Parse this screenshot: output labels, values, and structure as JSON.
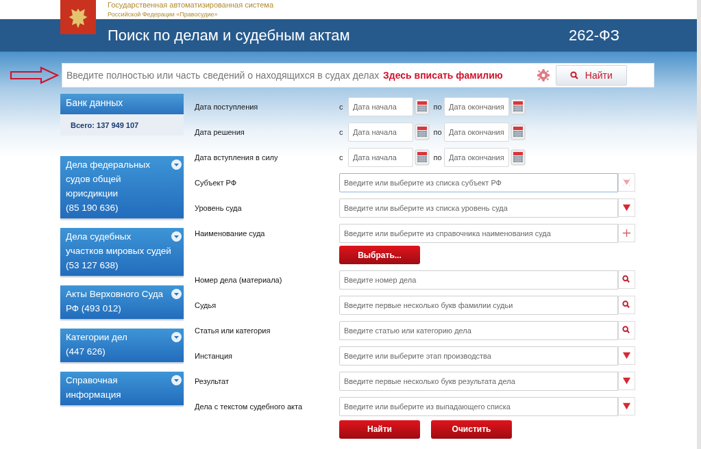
{
  "header": {
    "system_line_1": "Государственная автоматизированная система",
    "system_line_2": "Российской Федерации «Правосудие»",
    "title": "Поиск по делам и судебным актам",
    "law": "262-ФЗ"
  },
  "search": {
    "placeholder": "Введите полностью или часть сведений о находящихся в судах делах",
    "annotation": "Здесь вписать фамилию",
    "button": "Найти"
  },
  "sidebar": {
    "bank_title": "Банк данных",
    "total": "Всего: 137 949 107",
    "items": [
      {
        "lines": [
          "Дела федеральных",
          "судов общей",
          "юрисдикции",
          "(85 190 636)"
        ]
      },
      {
        "lines": [
          "Дела судебных",
          "участков мировых судей",
          "(53 127 638)"
        ]
      },
      {
        "lines": [
          "Акты Верховного Суда",
          "РФ (493 012)"
        ]
      },
      {
        "lines": [
          "Категории дел",
          "(447 626)"
        ]
      },
      {
        "lines": [
          "Справочная",
          "информация"
        ]
      }
    ]
  },
  "form": {
    "rows": [
      {
        "kind": "date",
        "label": "Дата поступления",
        "from": "с",
        "from_placeholder": "Дата начала",
        "to": "по",
        "to_placeholder": "Дата окончания"
      },
      {
        "kind": "date",
        "label": "Дата решения",
        "from": "с",
        "from_placeholder": "Дата начала",
        "to": "по",
        "to_placeholder": "Дата окончания"
      },
      {
        "kind": "date",
        "label": "Дата вступления в силу",
        "from": "с",
        "from_placeholder": "Дата начала",
        "to": "по",
        "to_placeholder": "Дата окончания"
      },
      {
        "kind": "field",
        "label": "Субъект РФ",
        "placeholder": "Введите или выберите из списка субъект РФ",
        "button": {
          "kind": "loading"
        },
        "focused": true
      },
      {
        "kind": "field",
        "label": "Уровень суда",
        "placeholder": "Введите или выберите из списка уровень суда",
        "button": {
          "kind": "dropdown"
        },
        "focused": false
      },
      {
        "kind": "field",
        "label": "Наименование суда",
        "placeholder": "Введите или выберите из справочника наименования суда",
        "button": {
          "kind": "add"
        },
        "focused": false,
        "extra_button": "Выбрать..."
      },
      {
        "kind": "field",
        "label": "Номер дела (материала)",
        "placeholder": "Введите номер дела",
        "button": {
          "kind": "search"
        },
        "focused": false
      },
      {
        "kind": "field",
        "label": "Судья",
        "placeholder": "Введите первые несколько букв фамилии судьи",
        "button": {
          "kind": "search"
        },
        "focused": false
      },
      {
        "kind": "field",
        "label": "Статья или категория",
        "placeholder": "Введите статью или категорию дела",
        "button": {
          "kind": "search"
        },
        "focused": false
      },
      {
        "kind": "field",
        "label": "Инстанция",
        "placeholder": "Введите или выберите этап производства",
        "button": {
          "kind": "dropdown"
        },
        "focused": false
      },
      {
        "kind": "field",
        "label": "Результат",
        "placeholder": "Введите первые несколько букв результата дела",
        "button": {
          "kind": "dropdown"
        },
        "focused": false
      },
      {
        "kind": "field",
        "label": "Дела с текстом судебного акта",
        "placeholder": "Введите или выберите из выпадающего списка",
        "button": {
          "kind": "dropdown"
        },
        "focused": false
      }
    ],
    "buttons": [
      "Найти",
      "Очистить"
    ]
  }
}
